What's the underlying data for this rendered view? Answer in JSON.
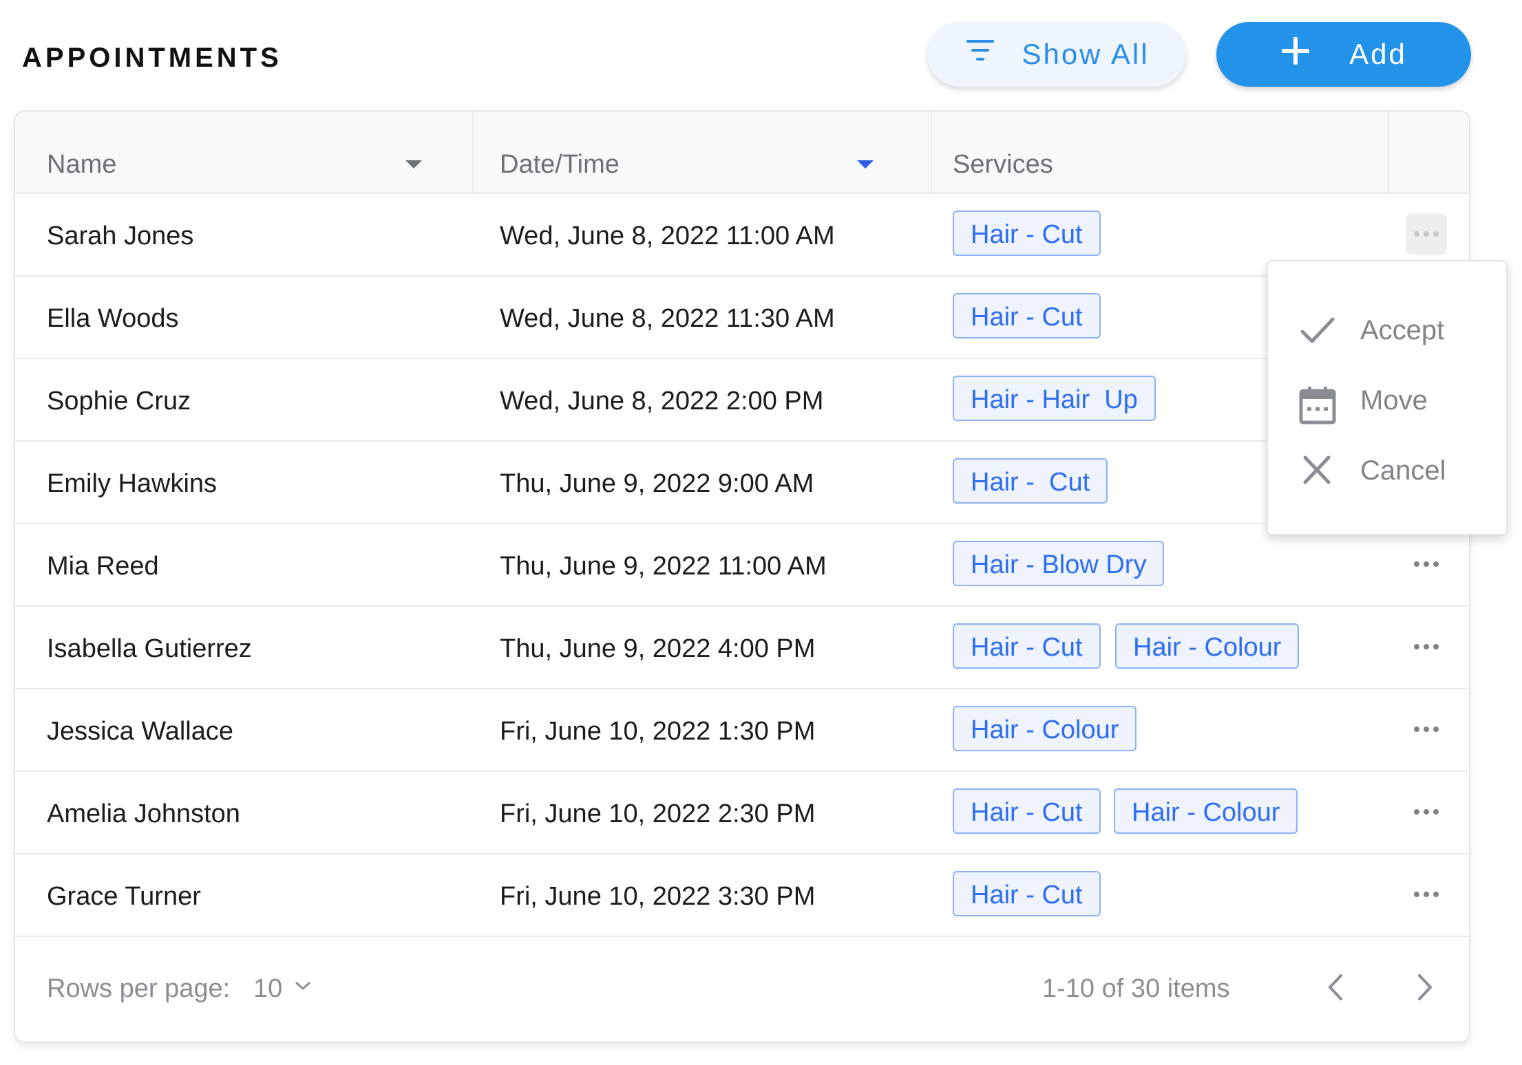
{
  "header": {
    "title": "APPOINTMENTS",
    "show_all_label": "Show All",
    "add_label": "Add"
  },
  "table": {
    "columns": [
      "Name",
      "Date/Time",
      "Services"
    ],
    "rows": [
      {
        "name": "Sarah Jones",
        "datetime": "Wed, June 8, 2022 11:00 AM",
        "services": [
          "Hair - Cut"
        ]
      },
      {
        "name": "Ella Woods",
        "datetime": "Wed, June 8, 2022 11:30 AM",
        "services": [
          "Hair - Cut"
        ]
      },
      {
        "name": "Sophie Cruz",
        "datetime": "Wed, June 8, 2022 2:00 PM",
        "services": [
          "Hair - Hair  Up"
        ]
      },
      {
        "name": "Emily Hawkins",
        "datetime": "Thu, June 9, 2022 9:00 AM",
        "services": [
          "Hair -  Cut"
        ]
      },
      {
        "name": "Mia Reed",
        "datetime": "Thu, June 9, 2022 11:00 AM",
        "services": [
          "Hair - Blow Dry"
        ]
      },
      {
        "name": "Isabella Gutierrez",
        "datetime": "Thu, June 9, 2022 4:00 PM",
        "services": [
          "Hair - Cut",
          "Hair - Colour"
        ]
      },
      {
        "name": "Jessica Wallace",
        "datetime": "Fri, June 10, 2022 1:30 PM",
        "services": [
          "Hair - Colour"
        ]
      },
      {
        "name": "Amelia Johnston",
        "datetime": "Fri, June 10, 2022 2:30 PM",
        "services": [
          "Hair - Cut",
          "Hair - Colour"
        ]
      },
      {
        "name": "Grace Turner",
        "datetime": "Fri, June 10, 2022 3:30 PM",
        "services": [
          "Hair - Cut"
        ]
      }
    ]
  },
  "footer": {
    "rows_per_page_label": "Rows per page:",
    "rows_per_page_value": "10",
    "range_text": "1-10 of 30 items"
  },
  "context_menu": {
    "items": [
      "Accept",
      "Move",
      "Cancel"
    ]
  },
  "colors": {
    "accent": "#2393e9",
    "tag_text": "#2d6df0",
    "tag_border": "#8fb1f5",
    "tag_bg": "#eef3fe"
  }
}
